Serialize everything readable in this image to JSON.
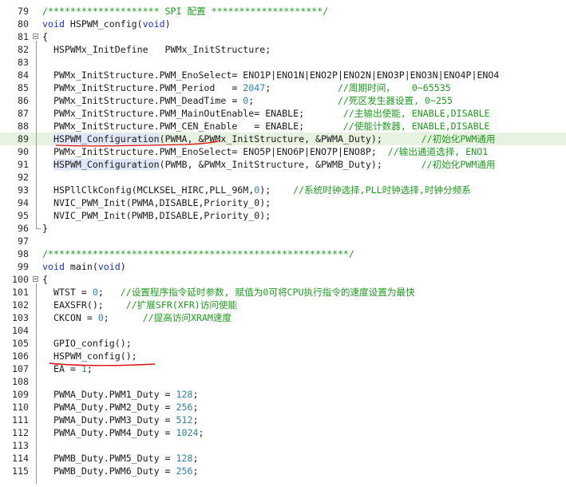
{
  "editor": {
    "lines": [
      {
        "num": "79",
        "tokens": [
          {
            "t": "/******************** SPI 配置 ********************/",
            "c": "cmt"
          }
        ]
      },
      {
        "num": "80",
        "tokens": [
          {
            "t": "void",
            "c": "kw"
          },
          {
            "t": " HSPWM_config(",
            "c": "plain"
          },
          {
            "t": "void",
            "c": "kw"
          },
          {
            "t": ")",
            "c": "plain"
          }
        ]
      },
      {
        "num": "81",
        "tokens": [
          {
            "t": "{",
            "c": "plain"
          }
        ]
      },
      {
        "num": "82",
        "tokens": [
          {
            "t": "  HSPWMx_InitDefine   PWMx_InitStructure;",
            "c": "plain"
          }
        ]
      },
      {
        "num": "83",
        "tokens": []
      },
      {
        "num": "84",
        "tokens": [
          {
            "t": "  PWMx_InitStructure.PWM_EnoSelect= ENO1P|ENO1N|ENO2P|ENO2N|ENO3P|ENO3N|ENO4P|ENO4",
            "c": "plain"
          }
        ]
      },
      {
        "num": "85",
        "tokens": [
          {
            "t": "  PWMx_InitStructure.PWM_Period   = ",
            "c": "plain"
          },
          {
            "t": "2047",
            "c": "num"
          },
          {
            "t": ";",
            "c": "plain"
          },
          {
            "t": "            //周期时间，   0~65535",
            "c": "cmt"
          }
        ]
      },
      {
        "num": "86",
        "tokens": [
          {
            "t": "  PWMx_InitStructure.PWM_DeadTime = ",
            "c": "plain"
          },
          {
            "t": "0",
            "c": "num"
          },
          {
            "t": ";",
            "c": "plain"
          },
          {
            "t": "               //死区发生器设置, 0~255",
            "c": "cmt"
          }
        ]
      },
      {
        "num": "87",
        "tokens": [
          {
            "t": "  PWMx_InitStructure.PWM_MainOutEnable= ENABLE;",
            "c": "plain"
          },
          {
            "t": "       //主输出使能, ENABLE,DISABLE",
            "c": "cmt"
          }
        ]
      },
      {
        "num": "88",
        "tokens": [
          {
            "t": "  PWMx_InitStructure.PWM_CEN_Enable   = ENABLE;",
            "c": "plain"
          },
          {
            "t": "       //使能计数器, ENABLE,DISABLE",
            "c": "cmt"
          }
        ]
      },
      {
        "num": "89",
        "hl": true,
        "tokens": [
          {
            "t": "  ",
            "c": "plain"
          },
          {
            "t": "HSPWM_Configuration",
            "c": "fn"
          },
          {
            "t": "(PWMA, &PWMx_InitStructure, &PWMA_Duty);",
            "c": "plain"
          },
          {
            "t": "       //初始化PWM通用",
            "c": "cmt"
          }
        ]
      },
      {
        "num": "90",
        "tokens": [
          {
            "t": "  PWMx_InitStructure.PWM_EnoSelect= ENO5P|ENO6P|ENO7P|ENO8P;",
            "c": "plain"
          },
          {
            "t": "  //输出通道选择, ENO1",
            "c": "cmt"
          }
        ]
      },
      {
        "num": "91",
        "tokens": [
          {
            "t": "  ",
            "c": "plain"
          },
          {
            "t": "HSPWM_Configuration",
            "c": "fn"
          },
          {
            "t": "(PWMB, &PWMx_InitStructure, &PWMB_Duty);",
            "c": "plain"
          },
          {
            "t": "       //初始化PWM通用",
            "c": "cmt"
          }
        ]
      },
      {
        "num": "92",
        "tokens": []
      },
      {
        "num": "93",
        "tokens": [
          {
            "t": "  HSPllClkConfig(MCLKSEL_HIRC,PLL_96M,",
            "c": "plain"
          },
          {
            "t": "0",
            "c": "num"
          },
          {
            "t": ");",
            "c": "plain"
          },
          {
            "t": "    //系统时钟选择,PLL时钟选择,时钟分频系",
            "c": "cmt"
          }
        ]
      },
      {
        "num": "94",
        "tokens": [
          {
            "t": "  NVIC_PWM_Init(PWMA,DISABLE,Priority_0);",
            "c": "plain"
          }
        ]
      },
      {
        "num": "95",
        "tokens": [
          {
            "t": "  NVIC_PWM_Init(PWMB,DISABLE,Priority_0);",
            "c": "plain"
          }
        ]
      },
      {
        "num": "96",
        "tokens": [
          {
            "t": "}",
            "c": "plain"
          }
        ]
      },
      {
        "num": "97",
        "tokens": []
      },
      {
        "num": "98",
        "tokens": [
          {
            "t": "/******************************************************/",
            "c": "cmt"
          }
        ]
      },
      {
        "num": "99",
        "tokens": [
          {
            "t": "void",
            "c": "kw"
          },
          {
            "t": " main(",
            "c": "plain"
          },
          {
            "t": "void",
            "c": "kw"
          },
          {
            "t": ")",
            "c": "plain"
          }
        ]
      },
      {
        "num": "100",
        "tokens": [
          {
            "t": "{",
            "c": "plain"
          }
        ]
      },
      {
        "num": "101",
        "tokens": [
          {
            "t": "  WTST = ",
            "c": "plain"
          },
          {
            "t": "0",
            "c": "num"
          },
          {
            "t": ";",
            "c": "plain"
          },
          {
            "t": "   //设置程序指令延时参数, 赋值为0可将CPU执行指令的速度设置为最快",
            "c": "cmt"
          }
        ]
      },
      {
        "num": "102",
        "tokens": [
          {
            "t": "  EAXSFR();",
            "c": "plain"
          },
          {
            "t": "    //扩展SFR(XFR)访问使能",
            "c": "cmt"
          }
        ]
      },
      {
        "num": "103",
        "tokens": [
          {
            "t": "  CKCON = ",
            "c": "plain"
          },
          {
            "t": "0",
            "c": "num"
          },
          {
            "t": ";",
            "c": "plain"
          },
          {
            "t": "      //提高访问XRAM速度",
            "c": "cmt"
          }
        ]
      },
      {
        "num": "104",
        "tokens": []
      },
      {
        "num": "105",
        "tokens": [
          {
            "t": "  GPIO_config();",
            "c": "plain"
          }
        ]
      },
      {
        "num": "106",
        "tokens": [
          {
            "t": "  HSPWM_config();",
            "c": "plain"
          }
        ]
      },
      {
        "num": "107",
        "tokens": [
          {
            "t": "  EA = ",
            "c": "plain"
          },
          {
            "t": "1",
            "c": "num"
          },
          {
            "t": ";",
            "c": "plain"
          }
        ]
      },
      {
        "num": "108",
        "tokens": []
      },
      {
        "num": "109",
        "tokens": [
          {
            "t": "  PWMA_Duty.PWM1_Duty = ",
            "c": "plain"
          },
          {
            "t": "128",
            "c": "num"
          },
          {
            "t": ";",
            "c": "plain"
          }
        ]
      },
      {
        "num": "110",
        "tokens": [
          {
            "t": "  PWMA_Duty.PWM2_Duty = ",
            "c": "plain"
          },
          {
            "t": "256",
            "c": "num"
          },
          {
            "t": ";",
            "c": "plain"
          }
        ]
      },
      {
        "num": "111",
        "tokens": [
          {
            "t": "  PWMA_Duty.PWM3_Duty = ",
            "c": "plain"
          },
          {
            "t": "512",
            "c": "num"
          },
          {
            "t": ";",
            "c": "plain"
          }
        ]
      },
      {
        "num": "112",
        "tokens": [
          {
            "t": "  PWMA_Duty.PWM4_Duty = ",
            "c": "plain"
          },
          {
            "t": "1024",
            "c": "num"
          },
          {
            "t": ";",
            "c": "plain"
          }
        ]
      },
      {
        "num": "113",
        "tokens": []
      },
      {
        "num": "114",
        "tokens": [
          {
            "t": "  PWMB_Duty.PWM5_Duty = ",
            "c": "plain"
          },
          {
            "t": "128",
            "c": "num"
          },
          {
            "t": ";",
            "c": "plain"
          }
        ]
      },
      {
        "num": "115",
        "tokens": [
          {
            "t": "  PWMB_Duty.PWM6_Duty = ",
            "c": "plain"
          },
          {
            "t": "256",
            "c": "num"
          },
          {
            "t": ";",
            "c": "plain"
          }
        ]
      }
    ]
  },
  "colors": {
    "keyword": "#1a33c8",
    "number": "#2f7fa8",
    "comment": "#1f9a1f",
    "annotation": "#e01010",
    "highlight_line": "#e8f2e0"
  }
}
